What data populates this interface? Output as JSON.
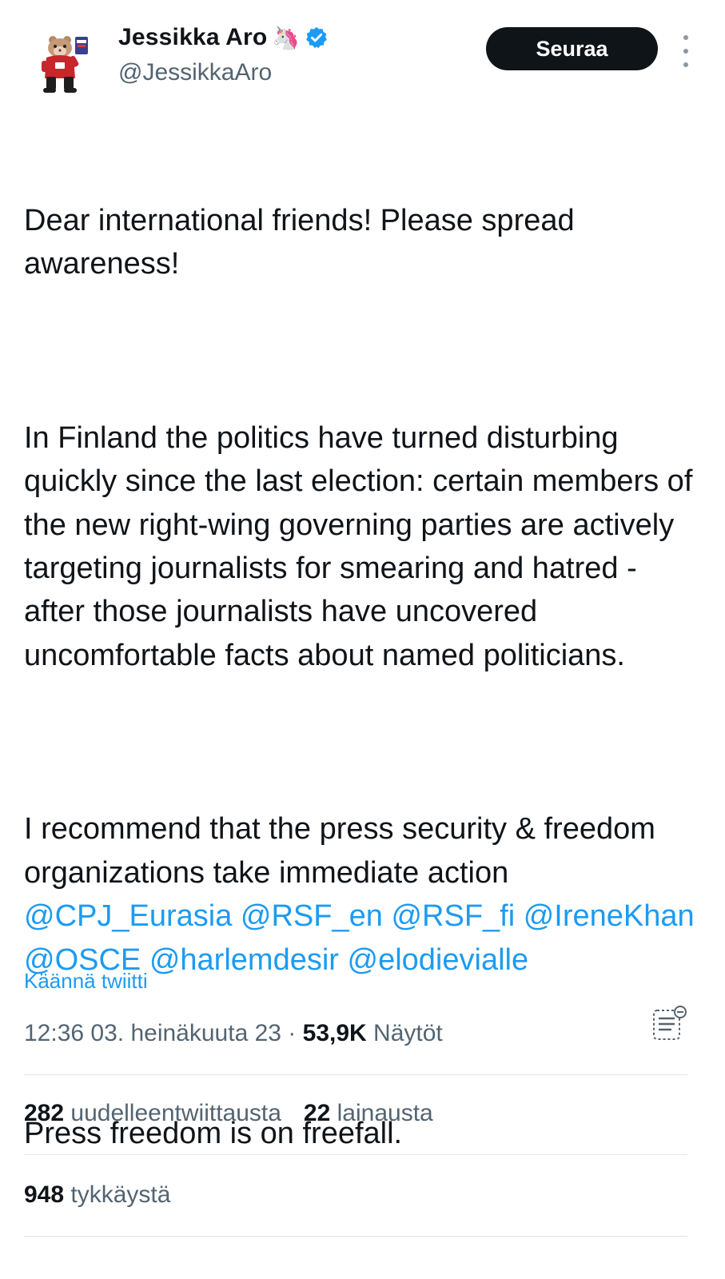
{
  "user": {
    "display_name": "Jessikka Aro",
    "name_emoji": "🦄",
    "verified_icon": "verified-badge-icon",
    "handle": "@JessikkaAro",
    "avatar": "hamster-mascot-avatar"
  },
  "actions": {
    "follow_label": "Seuraa",
    "more_icon": "vertical-ellipsis-icon"
  },
  "tweet": {
    "p1": "Dear international friends! Please spread awareness!",
    "p2": "In Finland the politics have turned disturbing quickly since the last election: certain members of the new right-wing governing parties are actively targeting journalists for smearing and hatred - after those journalists have uncovered uncomfortable facts about named politicians.",
    "p3_text": "I recommend that the press security & freedom organizations take immediate action ",
    "mentions": [
      "@CPJ_Eurasia",
      "@RSF_en",
      "@RSF_fi",
      "@IreneKhan",
      "@OSCE",
      "@harlemdesir",
      "@elodievialle"
    ],
    "p4": "Press freedom is on freefall."
  },
  "translate_label": "Käännä twiitti",
  "meta": {
    "time": "12:36",
    "date": "03. heinäkuuta 23",
    "separator": " · ",
    "views": "53,9K",
    "views_label": "Näytöt",
    "analytics_icon": "post-analytics-icon"
  },
  "stats": {
    "retweets_count": "282",
    "retweets_label": "uudelleentwiittausta",
    "quotes_count": "22",
    "quotes_label": "lainausta",
    "likes_count": "948",
    "likes_label": "tykkäystä"
  },
  "colors": {
    "text": "#0f1419",
    "secondary": "#536471",
    "link": "#1d9bf0",
    "button_bg": "#0f1419",
    "divider": "#e1e6ea"
  }
}
